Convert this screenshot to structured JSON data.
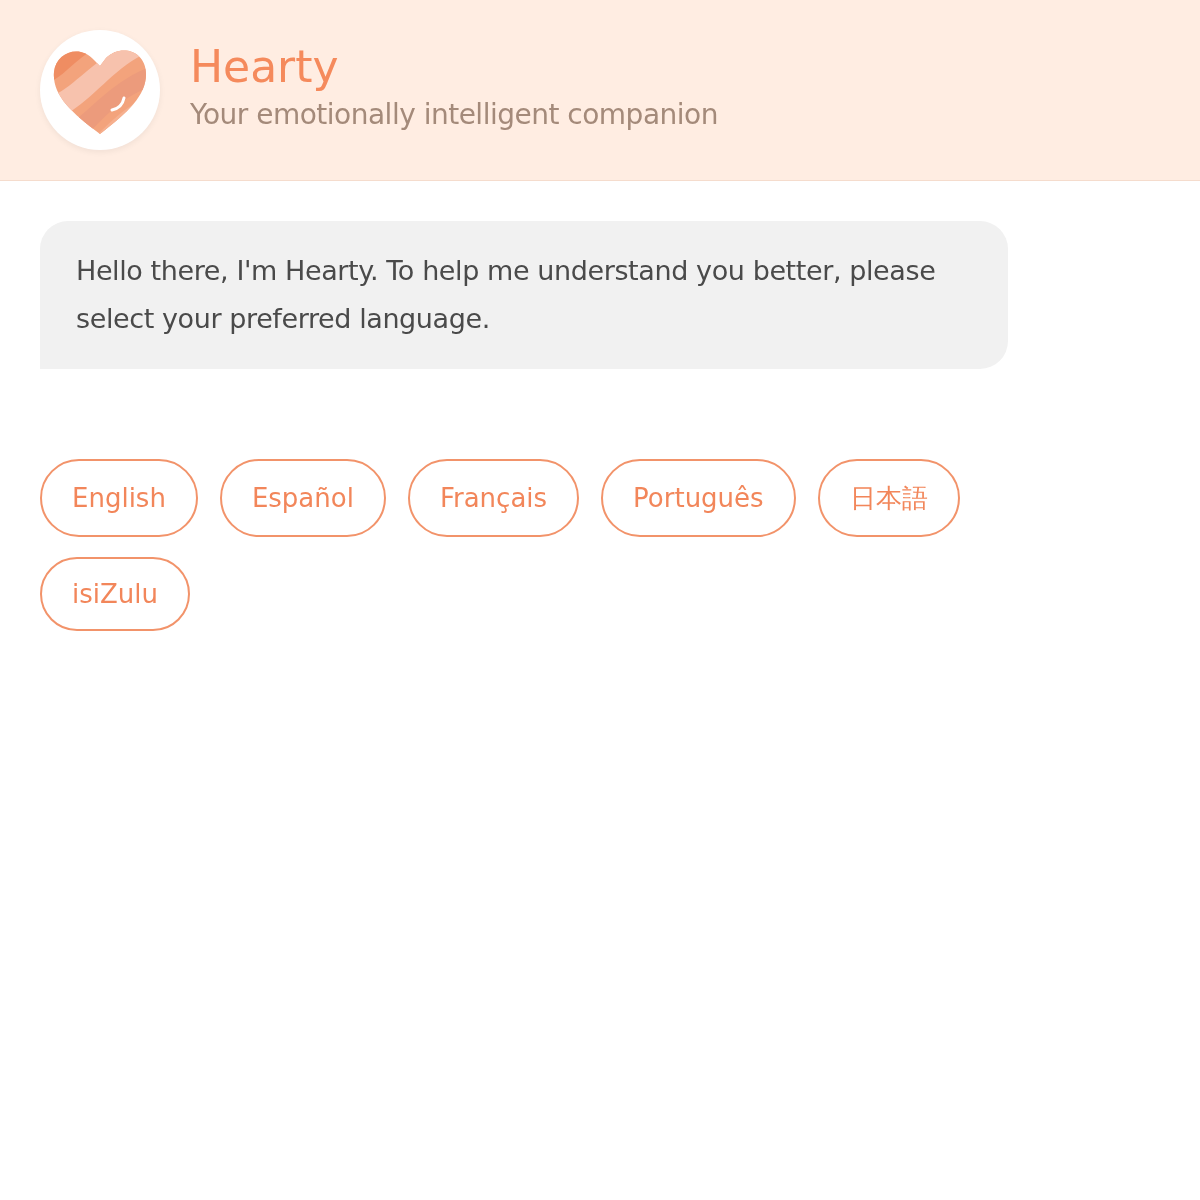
{
  "header": {
    "title": "Hearty",
    "subtitle": "Your emotionally intelligent companion"
  },
  "message": {
    "text": "Hello there, I'm Hearty. To help me understand you better, please select your preferred language."
  },
  "languages": [
    {
      "label": "English"
    },
    {
      "label": "Español"
    },
    {
      "label": "Français"
    },
    {
      "label": "Português"
    },
    {
      "label": "日本語"
    },
    {
      "label": "isiZulu"
    }
  ]
}
